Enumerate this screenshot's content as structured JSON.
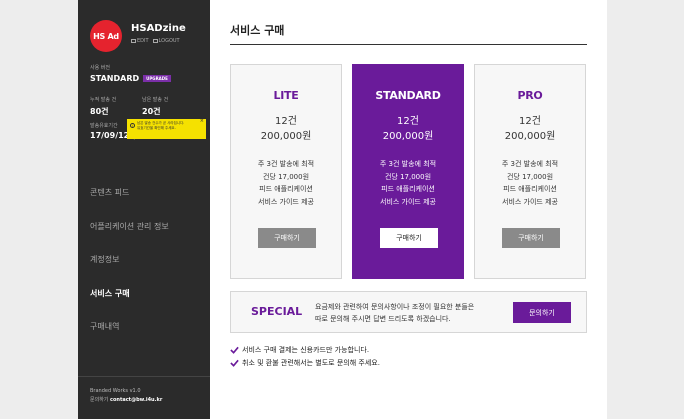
{
  "sidebar": {
    "logo_text": "HS Ad",
    "user_name": "HSADzine",
    "edit_label": "EDIT",
    "logout_label": "LOGOUT",
    "version_label": "사용 버전",
    "version_value": "STANDARD",
    "upgrade_label": "UPGRADE",
    "accum_label": "누적 발송 건",
    "accum_value": "80건",
    "remain_label": "남은 발송 건",
    "remain_value": "20건",
    "date_label": "발송유효기간",
    "date_value": "17/09/12 (",
    "tooltip_line1": "남은 발송 건수가 곧 사라집니다.",
    "tooltip_line2": "유효기간을 확인해 주세요.",
    "menu": [
      {
        "label": "콘텐츠 피드"
      },
      {
        "label": "어플리케이션 관리 정보"
      },
      {
        "label": "계정정보"
      },
      {
        "label": "서비스 구매"
      },
      {
        "label": "구매내역"
      }
    ],
    "footer_brand": "Branded Works v1.0",
    "footer_contact_label": "문의하기",
    "footer_contact_email": "contact@bw.i4u.kr"
  },
  "main": {
    "title": "서비스 구매",
    "plans": [
      {
        "name": "LITE",
        "count": "12건",
        "price": "200,000원",
        "features": [
          "주 3건 발송에 최적",
          "건당 17,000원",
          "피드 애플리케이션",
          "서비스 가이드 제공"
        ],
        "button": "구매하기"
      },
      {
        "name": "STANDARD",
        "count": "12건",
        "price": "200,000원",
        "features": [
          "주 3건 발송에 최적",
          "건당 17,000원",
          "피드 애플리케이션",
          "서비스 가이드 제공"
        ],
        "button": "구매하기"
      },
      {
        "name": "PRO",
        "count": "12건",
        "price": "200,000원",
        "features": [
          "주 3건 발송에 최적",
          "건당 17,000원",
          "피드 애플리케이션",
          "서비스 가이드 제공"
        ],
        "button": "구매하기"
      }
    ],
    "special": {
      "title": "SPECIAL",
      "line1": "요금제와 관련하여 문의사항이나 조정이 필요한 분들은",
      "line2": "따로 문의해 주시면 답변 드리도록 하겠습니다.",
      "button": "문의하기"
    },
    "notes": [
      "서비스 구매 결제는 신용카드만 가능합니다.",
      "취소 및 환불 관련해서는 별도로 문의해 주세요."
    ]
  },
  "colors": {
    "accent": "#6a1b9a",
    "sidebar_bg": "#2b2b2b",
    "logo_red": "#e5232e",
    "tooltip_yellow": "#f5e100"
  }
}
